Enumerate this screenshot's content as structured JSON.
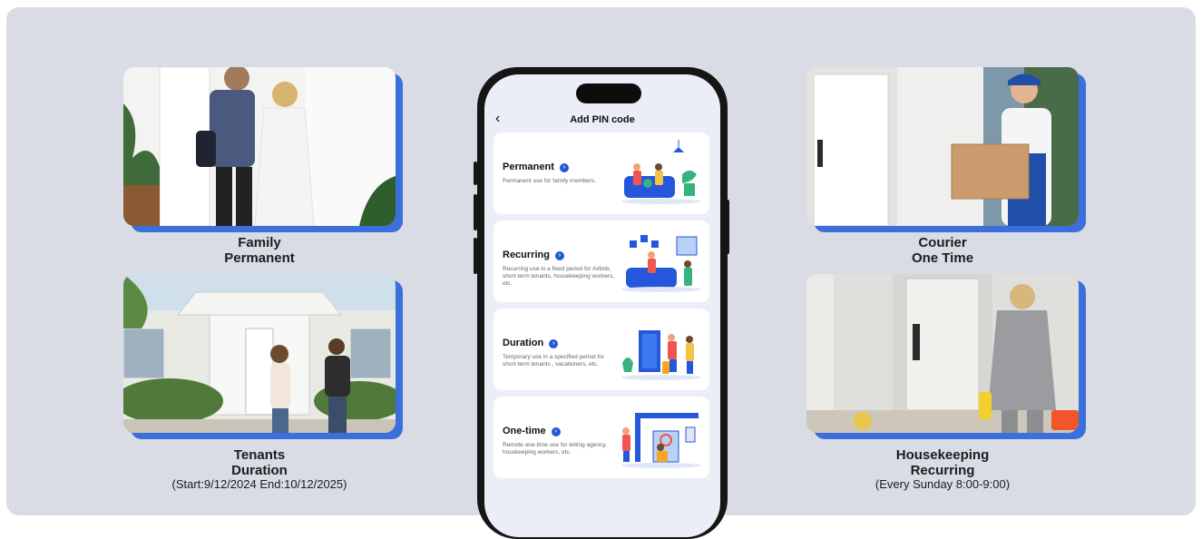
{
  "cards": {
    "family": {
      "title": "Family",
      "subtitle": "Permanent",
      "detail": ""
    },
    "tenants": {
      "title": "Tenants",
      "subtitle": "Duration",
      "detail": "(Start:9/12/2024 End:10/12/2025)"
    },
    "courier": {
      "title": "Courier",
      "subtitle": "One Time",
      "detail": ""
    },
    "housekeeping": {
      "title": "Housekeeping",
      "subtitle": "Recurring",
      "detail": "(Every Sunday 8:00-9:00)"
    }
  },
  "phone": {
    "title": "Add PIN code",
    "back_icon": "chevron-left-icon",
    "options": [
      {
        "title": "Permanent",
        "desc": "Permanent use for family members."
      },
      {
        "title": "Recurring",
        "desc": "Recurring use in a fixed period for Airbnb, short-term tenants, housekeeping workers, etc."
      },
      {
        "title": "Duration",
        "desc": "Temporary use in a specified period for short-term tenants , vacationers, etc."
      },
      {
        "title": "One-time",
        "desc": "Remote one-time use for letting agency, houskeeping workers, etc."
      }
    ]
  },
  "colors": {
    "accent": "#3b6fdc",
    "panel": "#d9dce5",
    "info_dot": "#2457d9"
  }
}
